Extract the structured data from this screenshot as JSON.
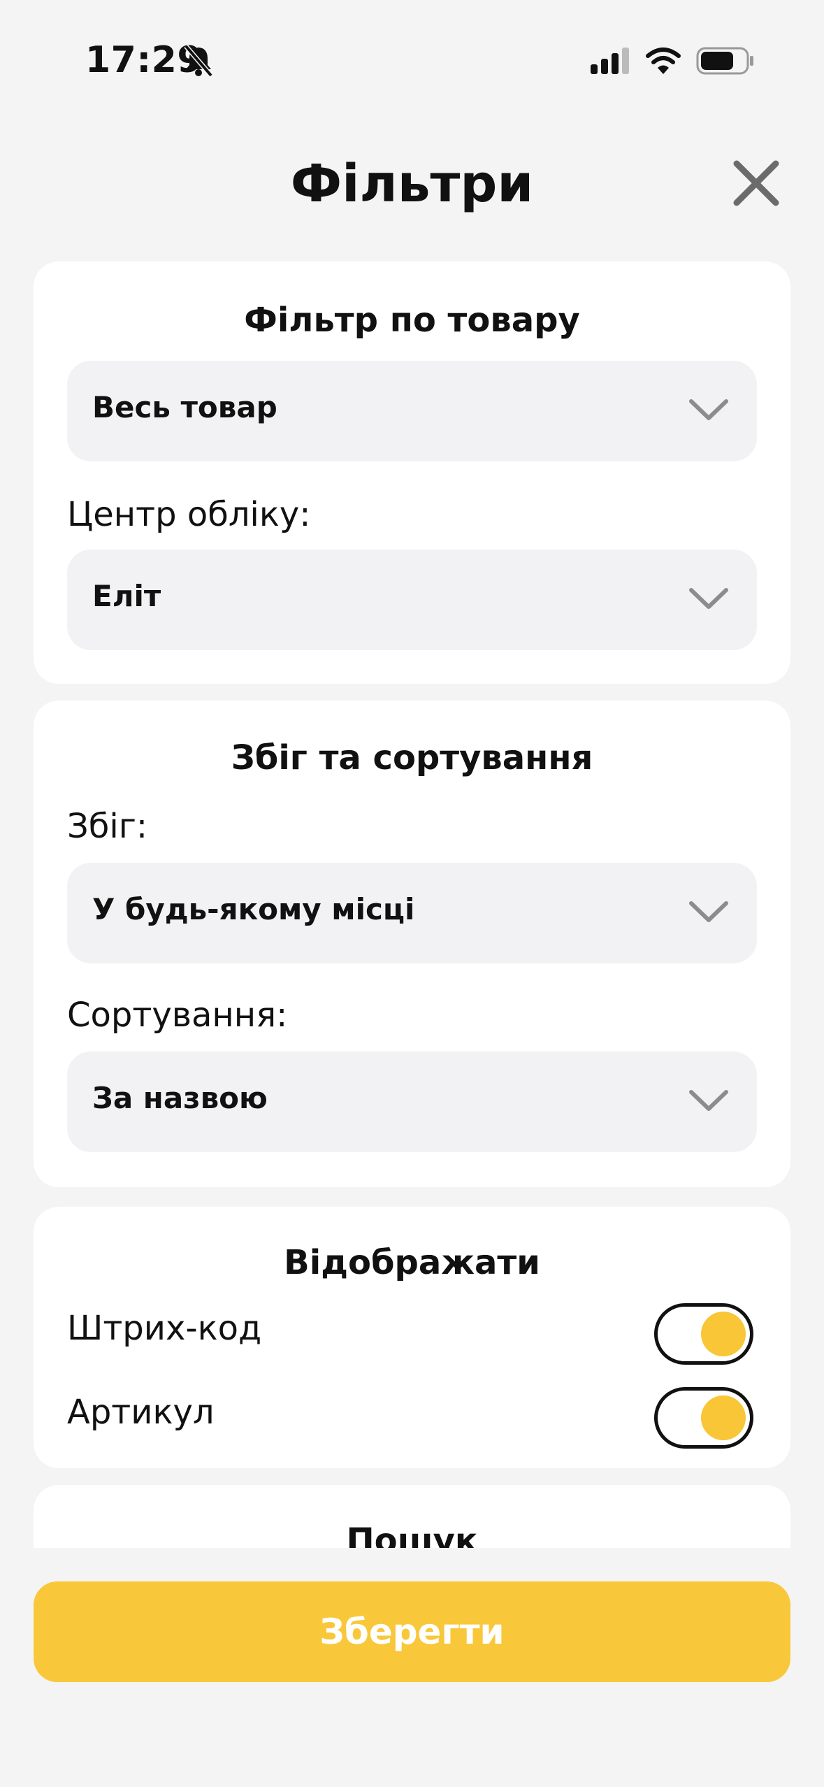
{
  "status_bar": {
    "time": "17:29"
  },
  "header": {
    "title": "Фільтри"
  },
  "product_filter": {
    "title": "Фільтр по товару",
    "product_select": "Весь товар",
    "center_label": "Центр обліку:",
    "center_select": "Еліт"
  },
  "match_sort": {
    "title": "Збіг та сортування",
    "match_label": "Збіг:",
    "match_select": "У будь-якому місці",
    "sort_label": "Сортування:",
    "sort_select": "За назвою"
  },
  "display": {
    "title": "Відображати",
    "toggles": [
      {
        "label": "Штрих-код",
        "on": true
      },
      {
        "label": "Артикул",
        "on": true
      }
    ]
  },
  "search": {
    "title": "Пошук"
  },
  "footer": {
    "save_label": "Зберегти"
  },
  "colors": {
    "accent": "#f8c83a",
    "field_bg": "#f2f2f4",
    "page_bg": "#f4f4f4"
  }
}
